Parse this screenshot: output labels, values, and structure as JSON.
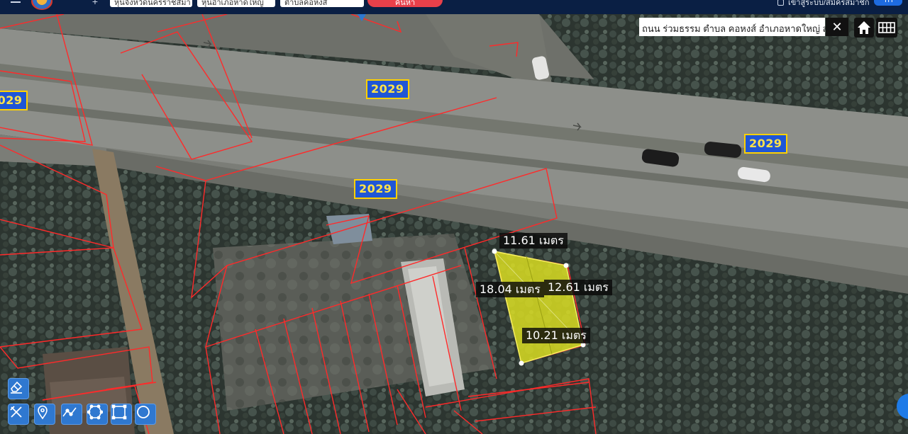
{
  "topbar": {
    "province": "หุ่นจังหวัดนครราชสีมา",
    "district": "หุ่นอำเภอหาดใหญ่",
    "subdistrict": "ตำบลคอหงส์",
    "search_label": "ค้นหา",
    "user_label": "เข้าสู่ระบบ/สมัครสมาชิก",
    "lang_label": "TH"
  },
  "map": {
    "road_labels": [
      "2029",
      "2029",
      "2029",
      "2029"
    ],
    "measurements": {
      "top": "11.61 เมตร",
      "left": "18.04 เมตร",
      "right": "12.61 เมตร",
      "bottom": "10.21 เมตร"
    },
    "address": "ถนน ร่วมธรรม ตำบล คอหงส์ อำเภอหาดใหญ่ สงขลา",
    "colors": {
      "parcel_line": "#ff2a2a",
      "selected_parcel": "#d9dd22",
      "road_label_bg": "#1f56d6",
      "road_label_text": "#ffe24a",
      "tool_bg": "#2f78d0"
    }
  },
  "icons": {
    "clear": "close-icon",
    "home": "home-icon",
    "grid": "grid-icon",
    "tools": [
      "eraser-icon",
      "measure-cross-icon",
      "pin-icon",
      "polyline-icon",
      "polygon-icon",
      "rectangle-icon",
      "circle-icon"
    ]
  }
}
